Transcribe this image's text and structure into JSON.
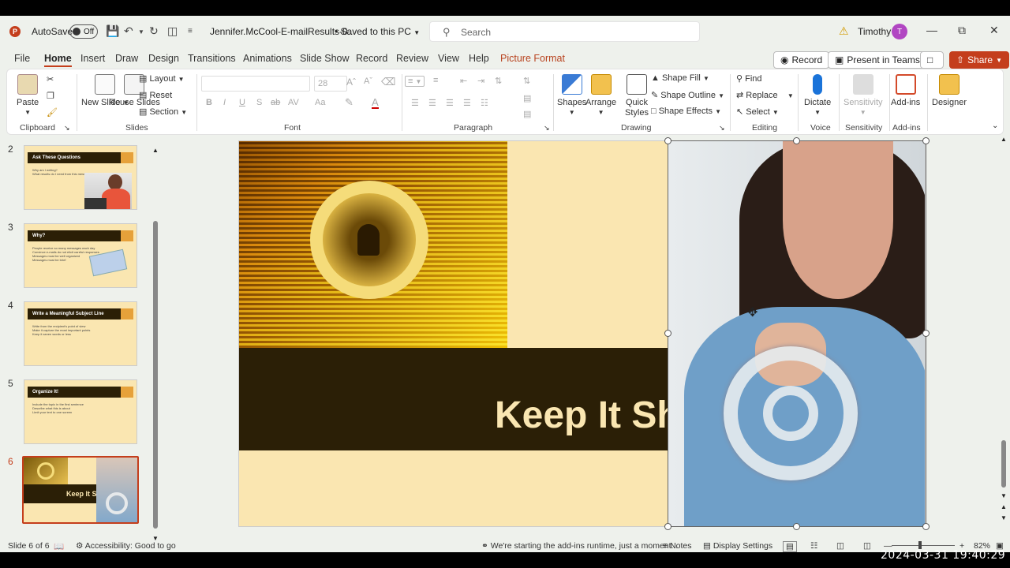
{
  "titlebar": {
    "autosave_label": "AutoSave",
    "autosave_state": "Off",
    "filename": "Jennifer.McCool-E-mailResults-0...",
    "saved_status": "Saved to this PC",
    "search_placeholder": "Search",
    "user_name": "Timothy",
    "user_initial": "T"
  },
  "menu": {
    "tabs": [
      "File",
      "Home",
      "Insert",
      "Draw",
      "Design",
      "Transitions",
      "Animations",
      "Slide Show",
      "Record",
      "Review",
      "View",
      "Help",
      "Picture Format"
    ],
    "active_tab": "Home",
    "record_label": "Record",
    "present_label": "Present in Teams",
    "share_label": "Share"
  },
  "ribbon": {
    "clipboard": {
      "paste": "Paste",
      "group": "Clipboard"
    },
    "slides": {
      "new_slide": "New Slide",
      "reuse_slides": "Reuse Slides",
      "layout": "Layout",
      "reset": "Reset",
      "section": "Section",
      "group": "Slides"
    },
    "font": {
      "size": "28",
      "group": "Font"
    },
    "paragraph": {
      "group": "Paragraph"
    },
    "drawing": {
      "shapes": "Shapes",
      "arrange": "Arrange",
      "quick_styles": "Quick Styles",
      "shape_fill": "Shape Fill",
      "shape_outline": "Shape Outline",
      "shape_effects": "Shape Effects",
      "group": "Drawing"
    },
    "editing": {
      "find": "Find",
      "replace": "Replace",
      "select": "Select",
      "group": "Editing"
    },
    "voice": {
      "dictate": "Dictate",
      "group": "Voice"
    },
    "sensitivity": {
      "label": "Sensitivity",
      "group": "Sensitivity"
    },
    "addins": {
      "label": "Add-ins",
      "group": "Add-ins"
    },
    "designer": {
      "label": "Designer"
    }
  },
  "thumbnails": [
    {
      "num": "2",
      "title": "Ask These Questions",
      "lines": [
        "Why am I writing?",
        "What results do I need from this message?"
      ]
    },
    {
      "num": "3",
      "title": "Why?",
      "lines": [
        "People receive so many messages each day",
        "Convince e-mails do not elicit careful responses",
        "Messages must be well organized",
        "Messages must be brief"
      ]
    },
    {
      "num": "4",
      "title": "Write a Meaningful Subject Line",
      "lines": [
        "Write from the recipient's point of view",
        "Make it capture the most important points",
        "Keep it seven words or less"
      ]
    },
    {
      "num": "5",
      "title": "Organize It!",
      "lines": [
        "Include the topic in the first sentence",
        "Describe what this is about",
        "Limit your text to one screen"
      ]
    },
    {
      "num": "6",
      "title": "Keep It Sh",
      "lines": []
    }
  ],
  "slide": {
    "title": "Keep It Sh"
  },
  "status": {
    "slide_count": "Slide 6 of 6",
    "accessibility": "Accessibility: Good to go",
    "addins_msg": "We're starting the add-ins runtime, just a moment...",
    "notes": "Notes",
    "display_settings": "Display Settings",
    "zoom": "82%"
  },
  "overlay": {
    "timestamp": "2024-03-31  19:40:29"
  }
}
